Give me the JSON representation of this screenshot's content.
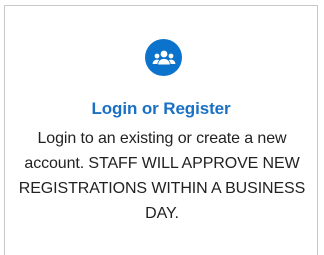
{
  "card": {
    "icon": "group-users-icon",
    "title": "Login or Register",
    "description": "Login to an existing or create a new account. STAFF WILL APPROVE NEW REGISTRATIONS WITHIN A BUSINESS DAY.",
    "colors": {
      "accent": "#0b73cc",
      "title": "#1a70c2",
      "text": "#222222",
      "border": "#c9c9c9"
    }
  }
}
